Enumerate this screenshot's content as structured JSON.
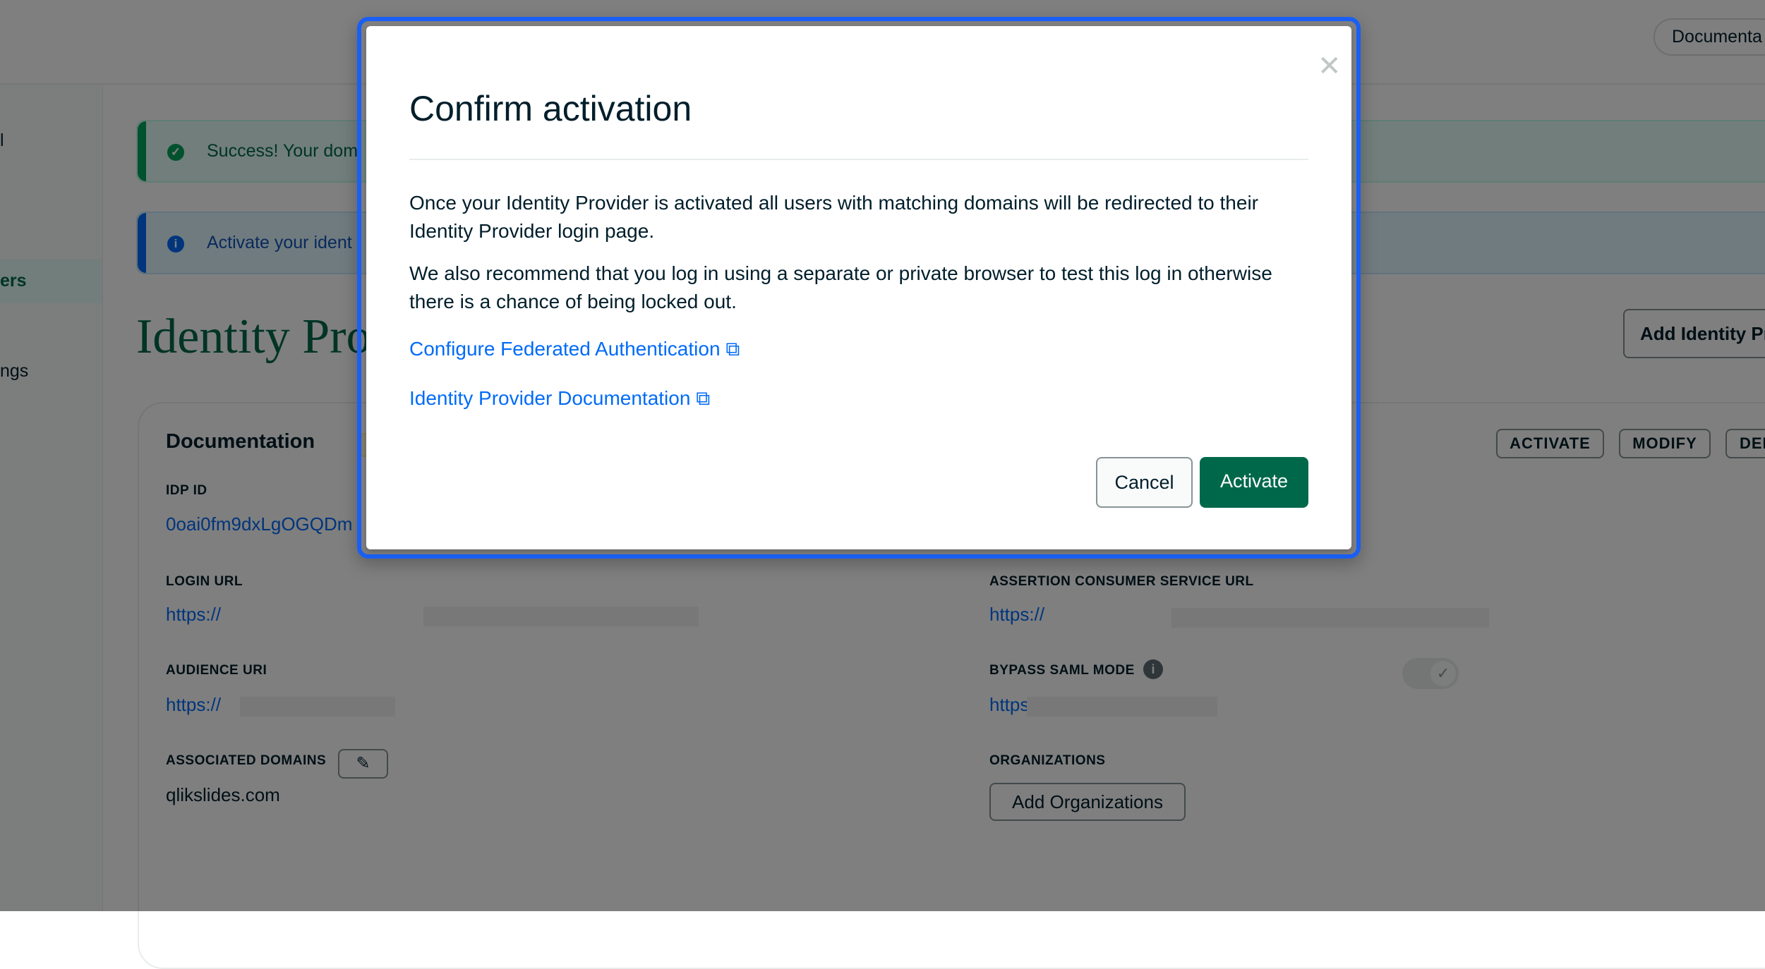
{
  "header": {
    "docs_pill": "Documenta"
  },
  "sidebar": {
    "items": [
      {
        "label": "l"
      },
      {
        "label": "ers",
        "selected": true
      },
      {
        "label": "ngs"
      }
    ]
  },
  "alerts": {
    "success": {
      "icon": "check-circle-icon",
      "text": "Success! Your dom"
    },
    "info": {
      "icon": "info-circle-icon",
      "text": "Activate your ident"
    }
  },
  "page": {
    "title": "Identity Pro",
    "add_button": "Add Identity Pr"
  },
  "card": {
    "title": "Documentation",
    "actions": {
      "activate": "ACTIVATE",
      "modify": "MODIFY",
      "delete": "DEL"
    },
    "idp_id_label": "IDP ID",
    "idp_id_value": "0oai0fm9dxLgOGQDm",
    "login_url_label": "LOGIN URL",
    "login_url_value": "https://",
    "audience_uri_label": "AUDIENCE URI",
    "audience_uri_value": "https://",
    "associated_domains_label": "ASSOCIATED DOMAINS",
    "associated_domains_value": "qlikslides.com",
    "acs_url_label": "ASSERTION CONSUMER SERVICE URL",
    "acs_url_value": "https://",
    "bypass_saml_label": "BYPASS SAML MODE",
    "bypass_saml_enabled": true,
    "bypass_saml_value": "https://",
    "organizations_label": "ORGANIZATIONS",
    "add_organizations": "Add Organizations"
  },
  "dialog": {
    "title": "Confirm activation",
    "paragraph1": "Once your Identity Provider is activated all users with matching domains will be redirected to their Identity Provider login page.",
    "paragraph2": "We also recommend that you log in using a separate or private browser to test this log in otherwise there is a chance of being locked out.",
    "link1": "Configure Federated Authentication",
    "link2": "Identity Provider Documentation",
    "cancel": "Cancel",
    "confirm": "Activate",
    "colors": {
      "primary": "#00684a",
      "link": "#016bf8",
      "focus_ring": "#1a5ff5"
    }
  }
}
